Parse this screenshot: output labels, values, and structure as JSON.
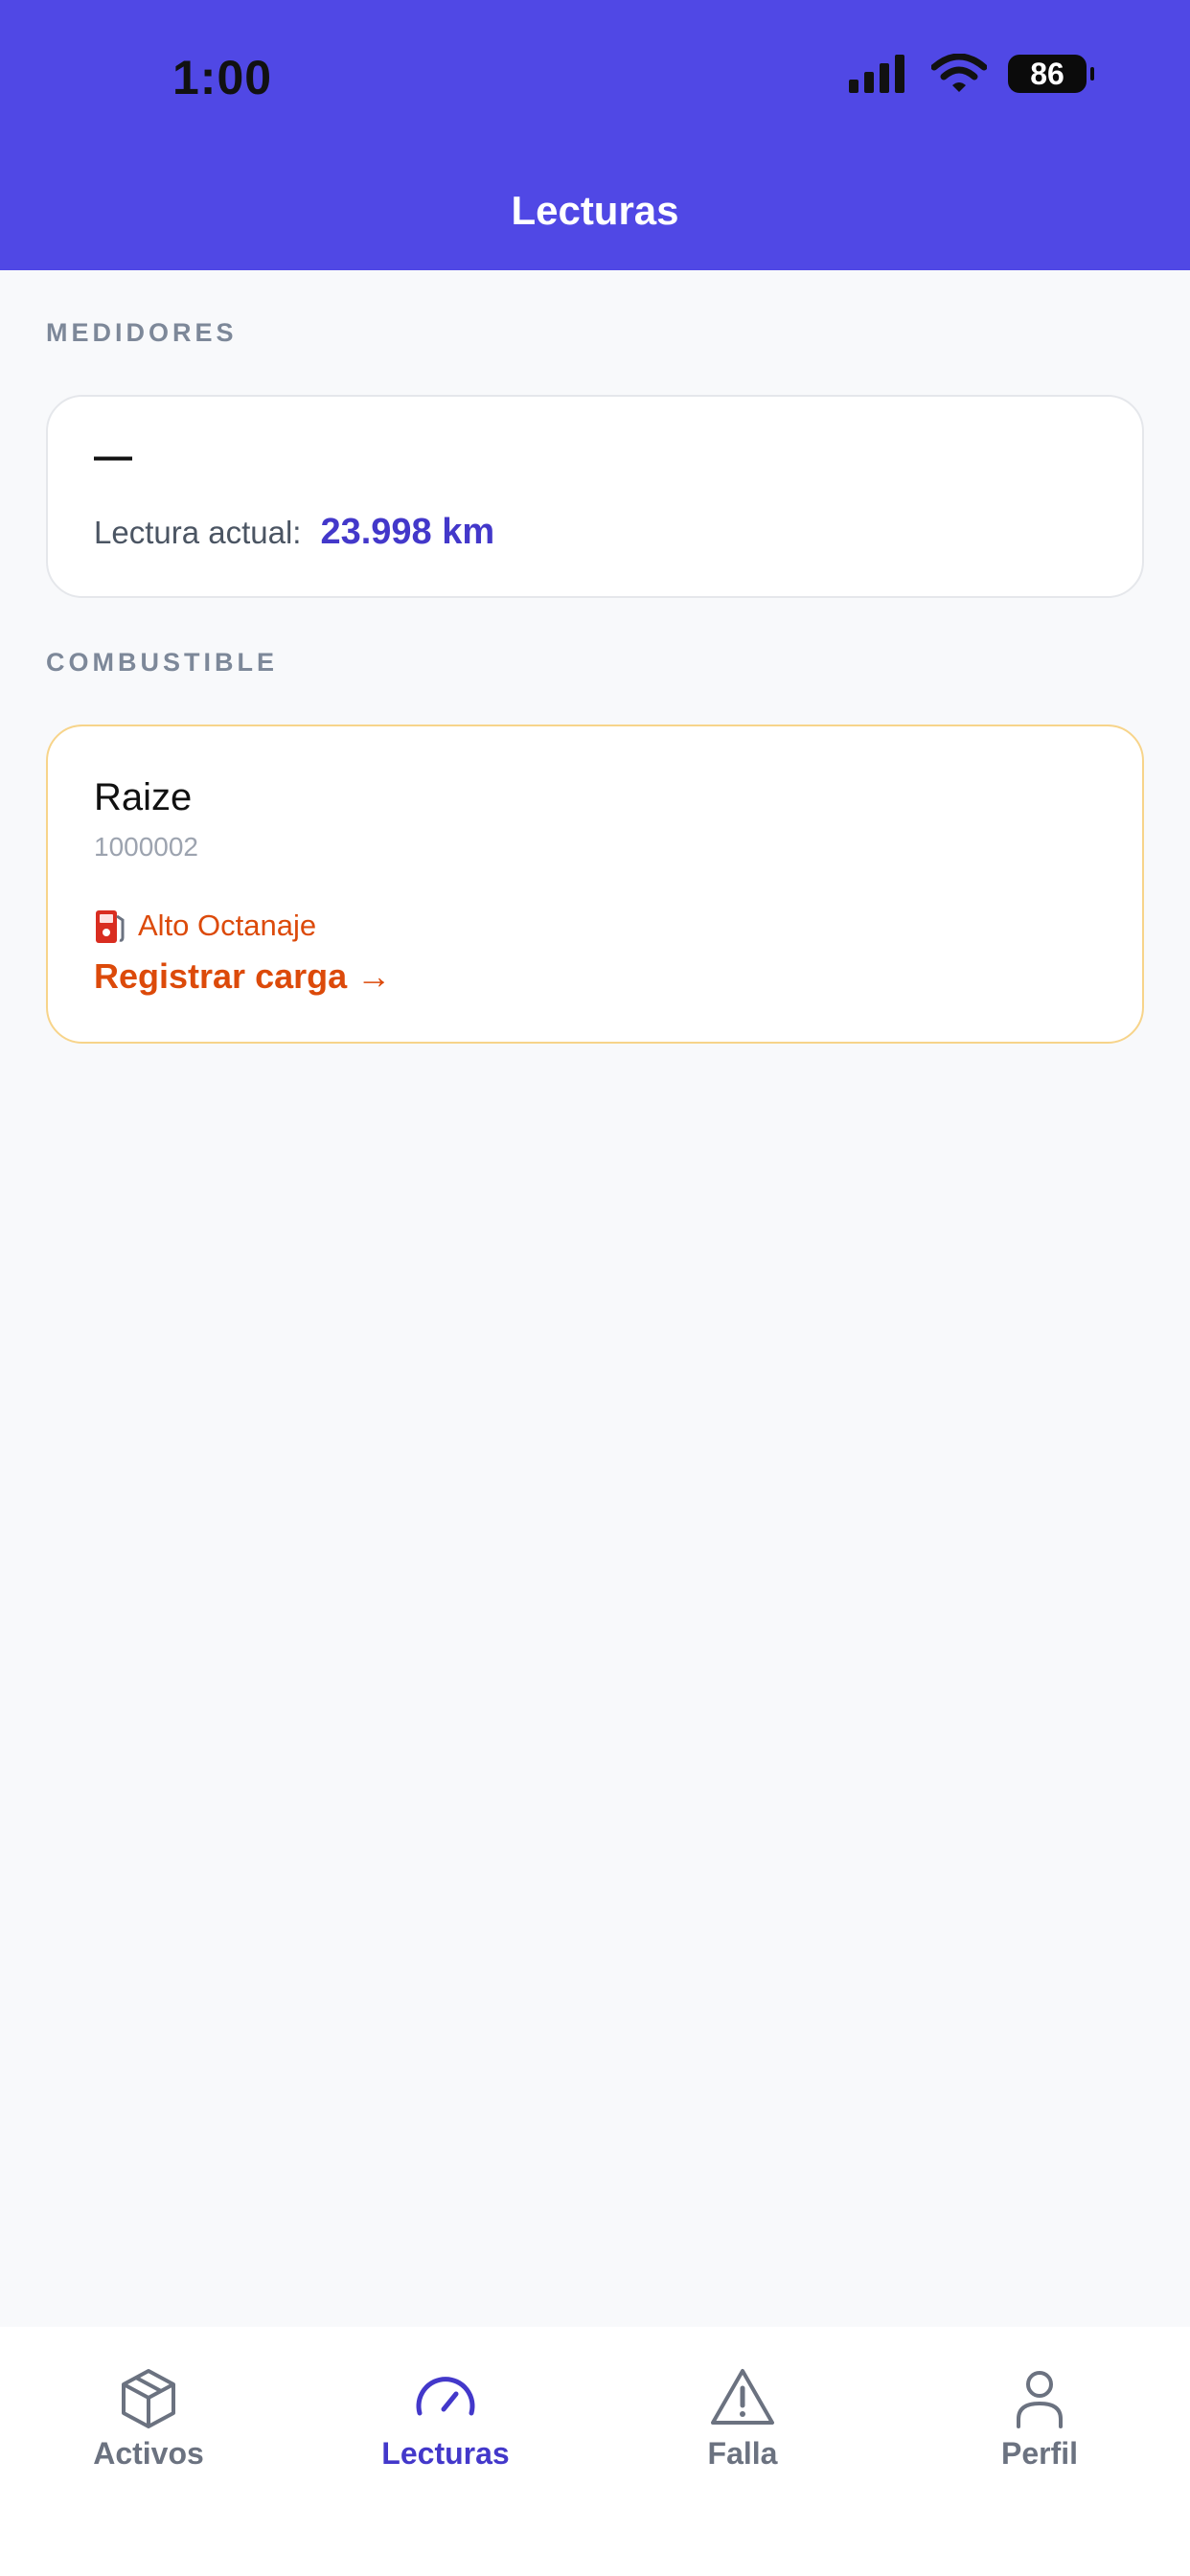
{
  "status_bar": {
    "time": "1:00",
    "battery": "86"
  },
  "header": {
    "title": "Lecturas"
  },
  "sections": {
    "meters": "MEDIDORES",
    "fuel": "COMBUSTIBLE"
  },
  "meter_card": {
    "name": "—",
    "label": "Lectura actual:",
    "value": "23.998 km"
  },
  "fuel_card": {
    "name": "Raize",
    "code": "1000002",
    "fuel_type": "Alto Octanaje",
    "action": "Registrar carga →"
  },
  "bottom_nav": [
    {
      "label": "Activos",
      "icon": "box-icon",
      "active": false
    },
    {
      "label": "Lecturas",
      "icon": "gauge-icon",
      "active": true
    },
    {
      "label": "Falla",
      "icon": "warning-icon",
      "active": false
    },
    {
      "label": "Perfil",
      "icon": "user-icon",
      "active": false
    }
  ],
  "colors": {
    "brand": "#5048e5",
    "accent": "#4338ca",
    "fuel": "#dc4a0a",
    "fuel_border": "#f7d48a"
  }
}
